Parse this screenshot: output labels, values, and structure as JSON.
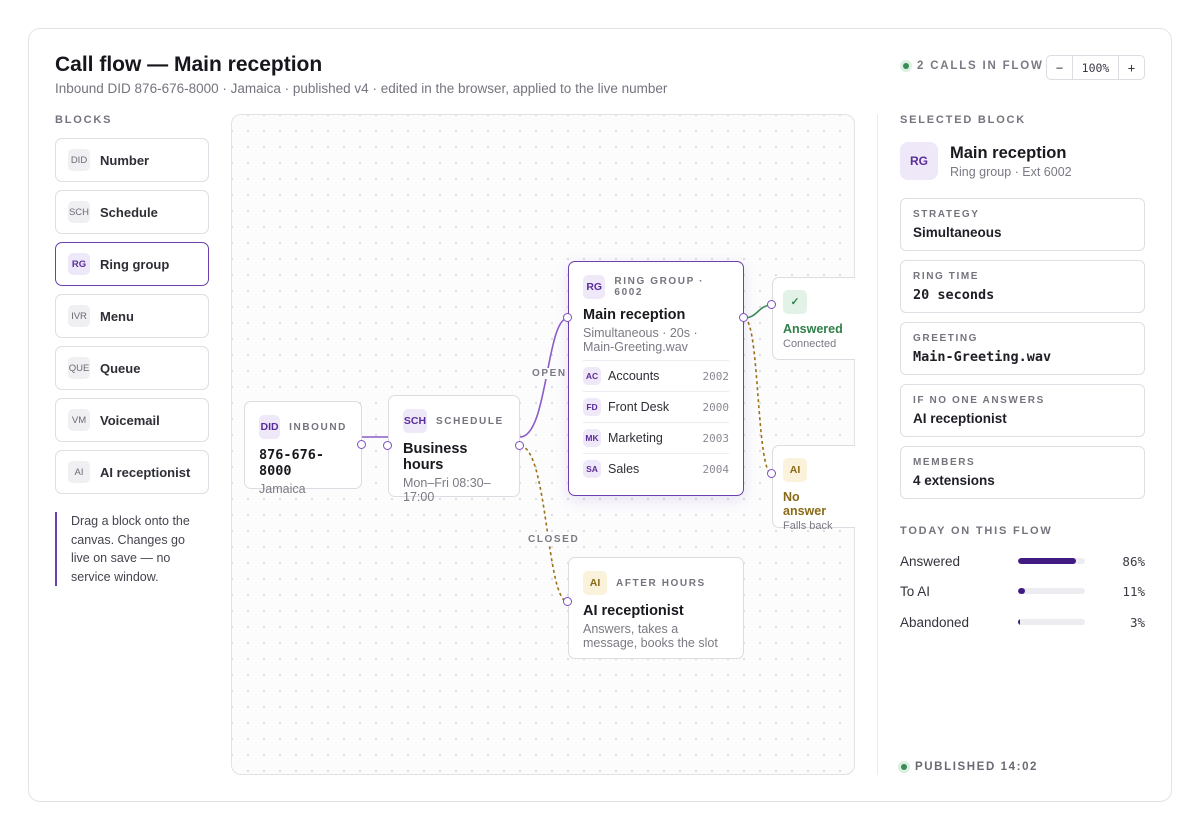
{
  "header": {
    "title": "Call flow — Main reception",
    "subtitle": "Inbound DID 876-676-8000 · Jamaica · published v4 · edited in the browser, applied to the live number",
    "calls_in_flow": "2 CALLS IN FLOW",
    "zoom": {
      "minus": "−",
      "value": "100%",
      "plus": "+"
    }
  },
  "palette": {
    "heading": "BLOCKS",
    "items": [
      {
        "abbr": "DID",
        "label": "Number",
        "icon": "did-icon"
      },
      {
        "abbr": "SCH",
        "label": "Schedule",
        "icon": "schedule-icon"
      },
      {
        "abbr": "RG",
        "label": "Ring group",
        "icon": "ring-group-icon",
        "selected": true
      },
      {
        "abbr": "IVR",
        "label": "Menu",
        "icon": "ivr-icon"
      },
      {
        "abbr": "QUE",
        "label": "Queue",
        "icon": "queue-icon"
      },
      {
        "abbr": "VM",
        "label": "Voicemail",
        "icon": "voicemail-icon"
      },
      {
        "abbr": "AI",
        "label": "AI receptionist",
        "icon": "ai-icon"
      }
    ],
    "hint": "Drag a block onto the canvas. Changes go live on save — no service window."
  },
  "canvas": {
    "edge_labels": {
      "open": "OPEN",
      "closed": "CLOSED"
    },
    "nodes": {
      "inbound": {
        "abbr": "DID",
        "type": "INBOUND",
        "title": "876-676-8000",
        "sub": "Jamaica"
      },
      "schedule": {
        "abbr": "SCH",
        "type": "SCHEDULE",
        "title": "Business hours",
        "sub": "Mon–Fri 08:30–17:00"
      },
      "ring_group": {
        "abbr": "RG",
        "type": "RING GROUP · 6002",
        "title": "Main reception",
        "sub": "Simultaneous · 20s · Main-Greeting.wav",
        "members": [
          {
            "abbr": "AC",
            "name": "Accounts",
            "ext": "2002"
          },
          {
            "abbr": "FD",
            "name": "Front Desk",
            "ext": "2000"
          },
          {
            "abbr": "MK",
            "name": "Marketing",
            "ext": "2003"
          },
          {
            "abbr": "SA",
            "name": "Sales",
            "ext": "2004"
          }
        ]
      },
      "answered": {
        "icon": "✓",
        "title": "Answered",
        "sub": "Connected"
      },
      "no_answer": {
        "abbr": "AI",
        "title": "No answer",
        "sub": "Falls back"
      },
      "after_hours": {
        "abbr": "AI",
        "type": "AFTER HOURS",
        "title": "AI receptionist",
        "sub": "Answers, takes a message, books the slot"
      }
    }
  },
  "inspector": {
    "heading": "SELECTED BLOCK",
    "abbr": "RG",
    "title": "Main reception",
    "sub": "Ring group · Ext 6002",
    "props": [
      {
        "label": "STRATEGY",
        "value": "Simultaneous",
        "mono": false
      },
      {
        "label": "RING TIME",
        "value": "20 seconds",
        "mono": true
      },
      {
        "label": "GREETING",
        "value": "Main-Greeting.wav",
        "mono": true
      },
      {
        "label": "IF NO ONE ANSWERS",
        "value": "AI receptionist",
        "mono": false
      },
      {
        "label": "MEMBERS",
        "value": "4 extensions",
        "mono": false
      }
    ],
    "stats_heading": "TODAY ON THIS FLOW",
    "stats": [
      {
        "label": "Answered",
        "percent": 86,
        "text": "86%"
      },
      {
        "label": "To AI",
        "percent": 11,
        "text": "11%"
      },
      {
        "label": "Abandoned",
        "percent": 3,
        "text": "3%"
      }
    ],
    "published": "PUBLISHED 14:02"
  },
  "colors": {
    "accent": "#6b3fae",
    "accent_dark": "#3f1b82",
    "success": "#2f7f4a",
    "warning": "#8a6a18"
  }
}
